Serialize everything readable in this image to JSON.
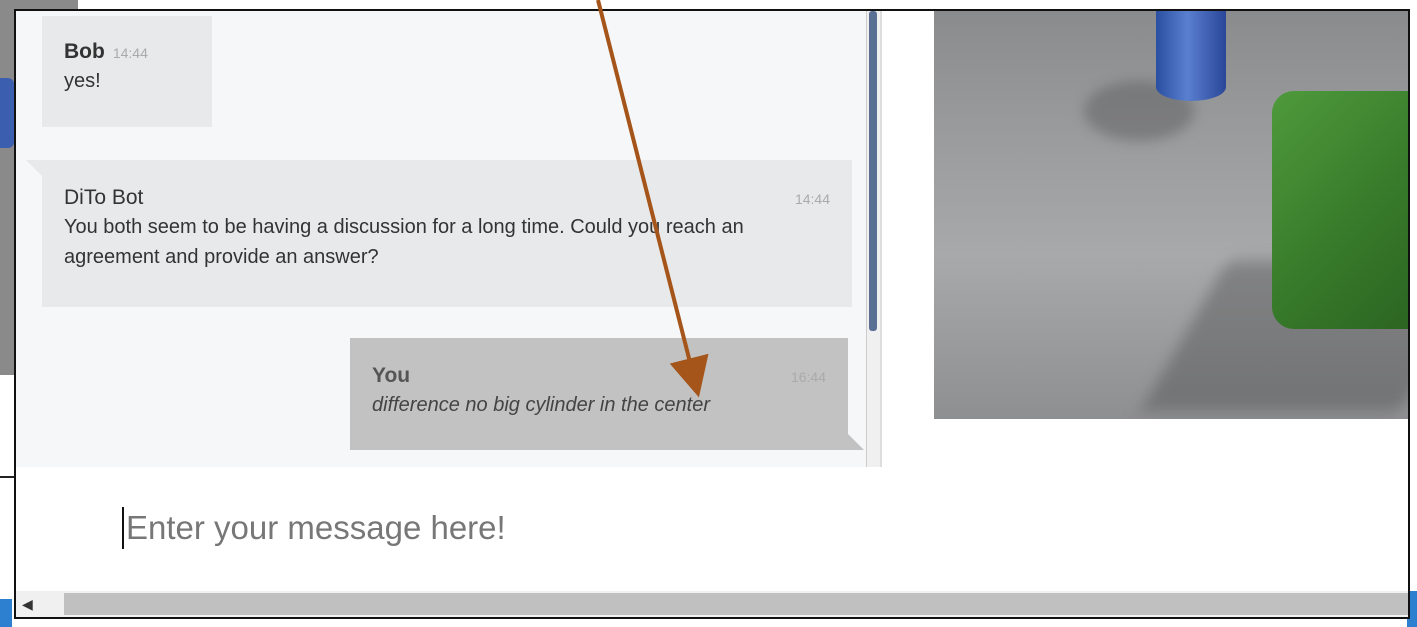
{
  "messages": [
    {
      "name": "Bob",
      "time": "14:44",
      "text": "yes!"
    },
    {
      "name": "DiTo Bot",
      "time": "14:44",
      "text": "You both seem to be having a discussion for a long time. Could you reach an agreement and provide an answer?"
    },
    {
      "name": "You",
      "time": "16:44",
      "text": "difference no big cylinder in the center"
    }
  ],
  "input": {
    "placeholder": "Enter your message here!"
  },
  "icons": {
    "scroll_left": "triangle-left-icon"
  },
  "colors": {
    "annotation_arrow": "#a55519",
    "scroll_thumb": "#5a6f94",
    "own_bubble": "#c2c2c2",
    "other_bubble": "#e8e9eb",
    "cube": "#3f8a30",
    "cylinder": "#3a5fb5"
  }
}
